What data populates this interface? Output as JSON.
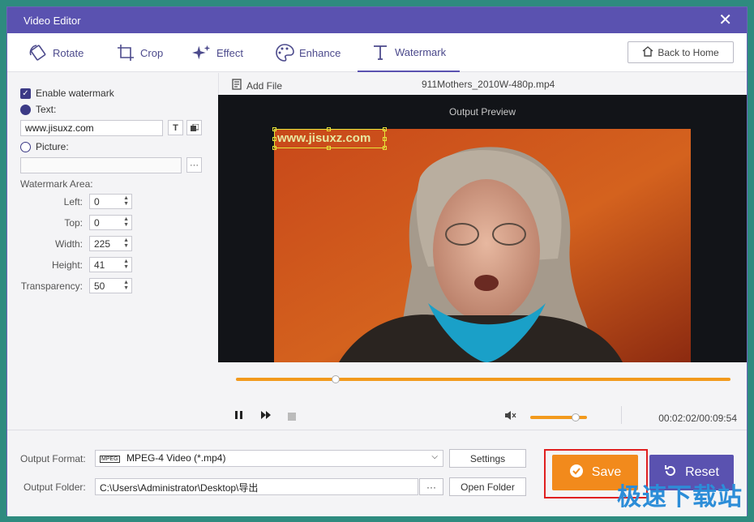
{
  "window": {
    "title": "Video Editor"
  },
  "tabs": [
    {
      "label": "Rotate"
    },
    {
      "label": "Crop"
    },
    {
      "label": "Effect"
    },
    {
      "label": "Enhance"
    },
    {
      "label": "Watermark"
    }
  ],
  "back_button": "Back to Home",
  "watermark": {
    "enable_label": "Enable watermark",
    "text_label": "Text:",
    "text_value": "www.jisuxz.com",
    "picture_label": "Picture:",
    "picture_value": "",
    "area_label": "Watermark Area:",
    "fields": [
      {
        "label": "Left:",
        "value": "0"
      },
      {
        "label": "Top:",
        "value": "0"
      },
      {
        "label": "Width:",
        "value": "225"
      },
      {
        "label": "Height:",
        "value": "41"
      },
      {
        "label": "Transparency:",
        "value": "50"
      }
    ]
  },
  "file": {
    "add_label": "Add File",
    "name": "911Mothers_2010W-480p.mp4"
  },
  "preview": {
    "caption": "Output Preview",
    "overlay_text": "www.jisuxz.com"
  },
  "playback": {
    "time": "00:02:02/00:09:54",
    "progress": 0.202,
    "volume": 0.8
  },
  "output": {
    "format_label": "Output Format:",
    "format_value": "MPEG-4 Video (*.mp4)",
    "format_badge": "MPEG",
    "settings_label": "Settings",
    "folder_label": "Output Folder:",
    "folder_value": "C:\\Users\\Administrator\\Desktop\\导出",
    "browse_label": "···",
    "open_folder_label": "Open Folder"
  },
  "actions": {
    "save": "Save",
    "reset": "Reset"
  },
  "brand_watermark": "极速下载站",
  "colors": {
    "accent": "#5a52b0",
    "save": "#f28a1c",
    "progress": "#f29a1d"
  }
}
